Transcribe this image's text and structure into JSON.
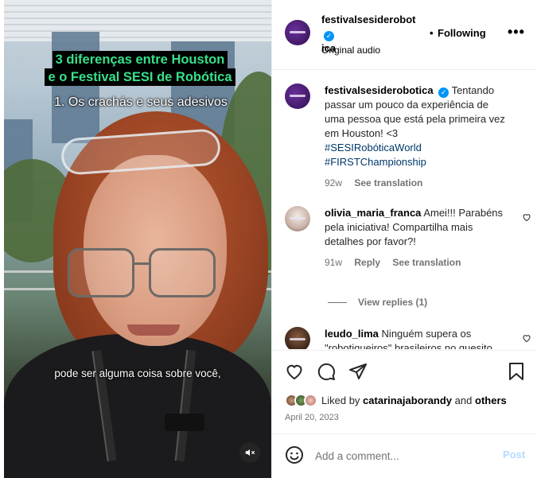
{
  "video": {
    "title_line1": "3 diferenças entre Houston",
    "title_line2": "e o Festival SESI de Robótica",
    "subtitle": "1. Os crachás e seus adesivos",
    "caption": "pode ser alguma coisa sobre você,",
    "mute_icon": "speaker-muted-icon"
  },
  "header": {
    "username": "festivalsesiderobotica",
    "username_line1": "festivalsesiderobot",
    "username_line2": "ica",
    "verified": true,
    "separator": "•",
    "follow_label": "Following",
    "more_label": "•••",
    "audio": "Original audio"
  },
  "caption_post": {
    "username": "festivalsesiderobotica",
    "text": "Tentando passar um pouco da experiência de uma pessoa que está pela primeira vez em Houston! <3",
    "tags": [
      "#SESIRobóticaWorld",
      "#FIRSTChampionship"
    ],
    "age": "92w",
    "translate": "See translation"
  },
  "comments": [
    {
      "username": "olivia_maria_franca",
      "text": "Amei!!! Parabéns pela iniciativa! Compartilha mais detalhes por favor?!",
      "age": "91w",
      "reply": "Reply",
      "translate": "See translation",
      "view_replies": "View replies (1)"
    },
    {
      "username": "leudo_lima",
      "text": "Ninguém supera os \"robotiqueiros\" brasileiros no quesito"
    }
  ],
  "actions": {
    "liked_prefix": "Liked by",
    "liked_user": "catarinajaborandy",
    "liked_and": "and",
    "liked_others": "others",
    "date": "April 20, 2023"
  },
  "add_comment": {
    "placeholder": "Add a comment...",
    "post_label": "Post"
  },
  "colors": {
    "accent": "#0095f6",
    "title_text": "#37e08a",
    "post_disabled": "#b3dbff",
    "tag_link": "#00376b"
  }
}
